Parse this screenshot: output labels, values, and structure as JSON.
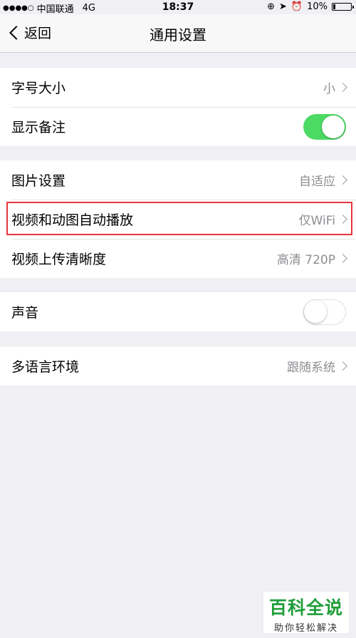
{
  "status_bar": {
    "signal": "●●●●○",
    "carrier": "中国联通",
    "network": "4G",
    "time": "18:37",
    "battery": "10%"
  },
  "nav": {
    "back_label": "返回",
    "title": "通用设置"
  },
  "groups": [
    {
      "rows": [
        {
          "label": "字号大小",
          "value": "小"
        },
        {
          "label": "显示备注",
          "toggle": true
        }
      ]
    },
    {
      "rows": [
        {
          "label": "图片设置",
          "value": "自适应"
        },
        {
          "label": "视频和动图自动播放",
          "value": "仅WiFi"
        },
        {
          "label": "视频上传清晰度",
          "value": "高清 720P"
        }
      ]
    },
    {
      "rows": [
        {
          "label": "声音",
          "toggle": false
        }
      ]
    },
    {
      "rows": [
        {
          "label": "多语言环境",
          "value": "跟随系统"
        }
      ]
    }
  ],
  "watermark": {
    "main": "百科全说",
    "sub": "助你轻松解决"
  },
  "colors": {
    "toggle_on": "#4cd964",
    "highlight_box": "#e8343a",
    "watermark_green": "#1f9e3a"
  }
}
